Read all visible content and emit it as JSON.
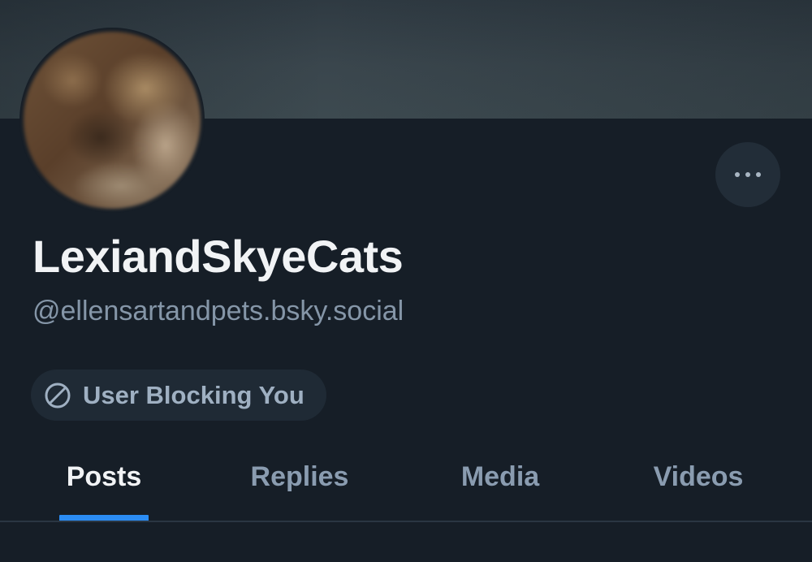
{
  "profile": {
    "display_name": "LexiandSkyeCats",
    "handle": "@ellensartandpets.bsky.social",
    "avatar": "blurred-cat-photo"
  },
  "actions": {
    "more_icon": "ellipsis-icon"
  },
  "status": {
    "icon": "block-icon",
    "label": "User Blocking You"
  },
  "tabs": [
    {
      "label": "Posts",
      "active": true
    },
    {
      "label": "Replies",
      "active": false
    },
    {
      "label": "Media",
      "active": false
    },
    {
      "label": "Videos",
      "active": false
    }
  ],
  "colors": {
    "background": "#161e27",
    "accent": "#2b8cf3",
    "muted_text": "#8596a8",
    "primary_text": "#f1f3f5"
  }
}
